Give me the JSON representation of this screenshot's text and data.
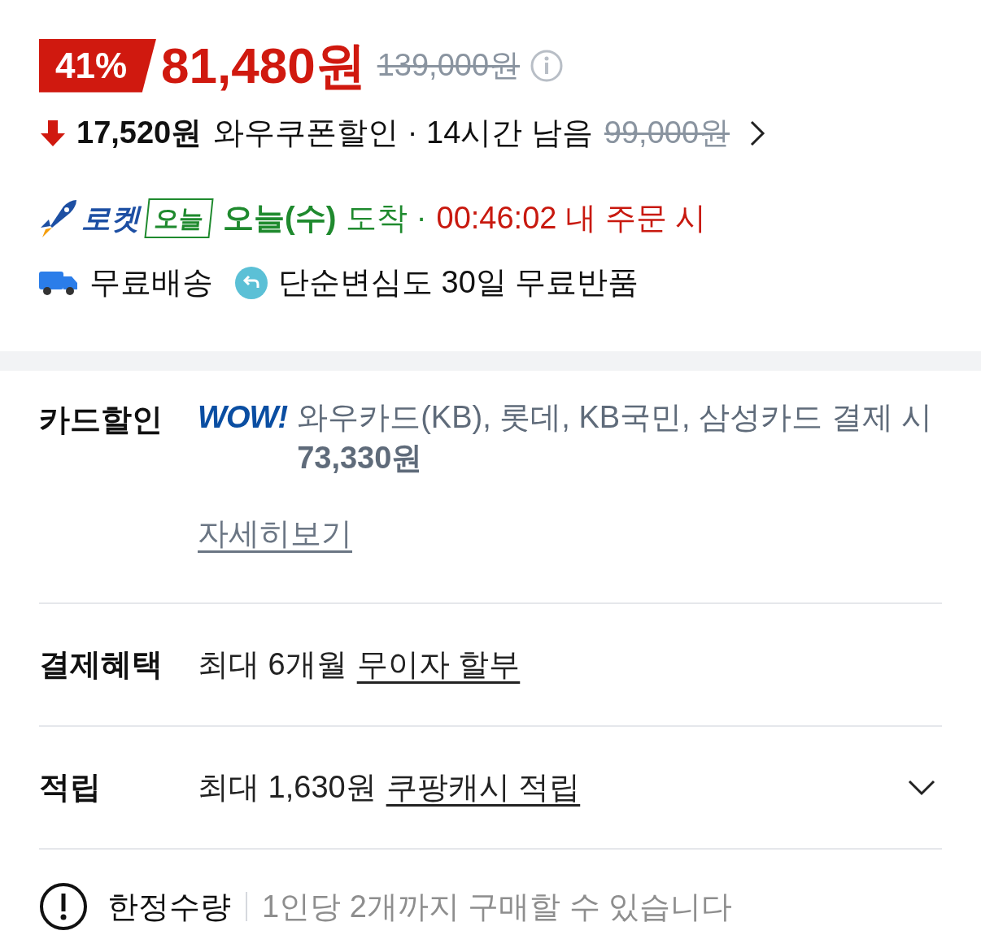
{
  "price": {
    "discount": "41%",
    "sale_price": "81,480원",
    "original_price": "139,000원"
  },
  "coupon": {
    "amount": "17,520원",
    "label": "와우쿠폰할인 · 14시간 남음",
    "original_price": "99,000원"
  },
  "delivery": {
    "brand": "로켓",
    "badge": "오늘",
    "arrival": "오늘(수)",
    "arrival_suffix": "도착 ·",
    "deadline": "00:46:02 내 주문 시"
  },
  "shipping": {
    "free_shipping": "무료배송",
    "free_return": "단순변심도 30일 무료반품"
  },
  "benefits": [
    {
      "kind": "card",
      "label": "카드할인",
      "logo": "WOW!",
      "text": "와우카드(KB), 롯데, KB국민, 삼성카드 결제 시  **73,330원**",
      "link": "자세히보기"
    },
    {
      "kind": "installment",
      "label": "결제혜택",
      "text": "최대 6개월",
      "link": "무이자 할부"
    },
    {
      "kind": "points",
      "label": "적립",
      "text": "최대 1,630원",
      "link": "쿠팡캐시 적립",
      "expanded": false
    }
  ],
  "notice": {
    "title": "한정수량",
    "text": "1인당 2개까지 구매할 수 있습니다"
  }
}
